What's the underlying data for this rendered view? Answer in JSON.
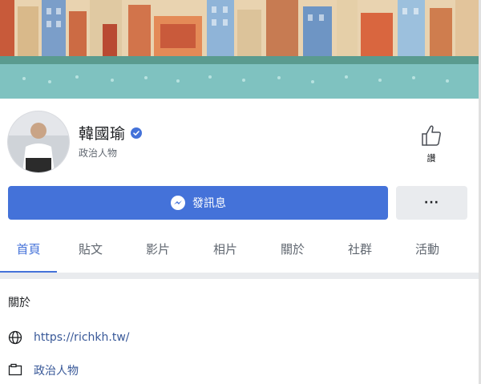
{
  "profile": {
    "name": "韓國瑜",
    "category": "政治人物"
  },
  "like": {
    "label": "讚"
  },
  "actions": {
    "message_label": "發訊息",
    "more_label": "···"
  },
  "tabs": [
    {
      "label": "首頁",
      "active": true
    },
    {
      "label": "貼文",
      "active": false
    },
    {
      "label": "影片",
      "active": false
    },
    {
      "label": "相片",
      "active": false
    },
    {
      "label": "關於",
      "active": false
    },
    {
      "label": "社群",
      "active": false
    },
    {
      "label": "活動",
      "active": false
    }
  ],
  "about": {
    "title": "關於",
    "website": "https://richkh.tw/",
    "category": "政治人物"
  },
  "icons": {
    "verified": "verified-badge-icon",
    "like": "thumbs-up-icon",
    "messenger": "messenger-icon",
    "globe": "globe-icon",
    "category": "category-icon"
  },
  "colors": {
    "accent": "#4472d9",
    "link": "#385898",
    "cover_teal": "#7fc2c0"
  }
}
